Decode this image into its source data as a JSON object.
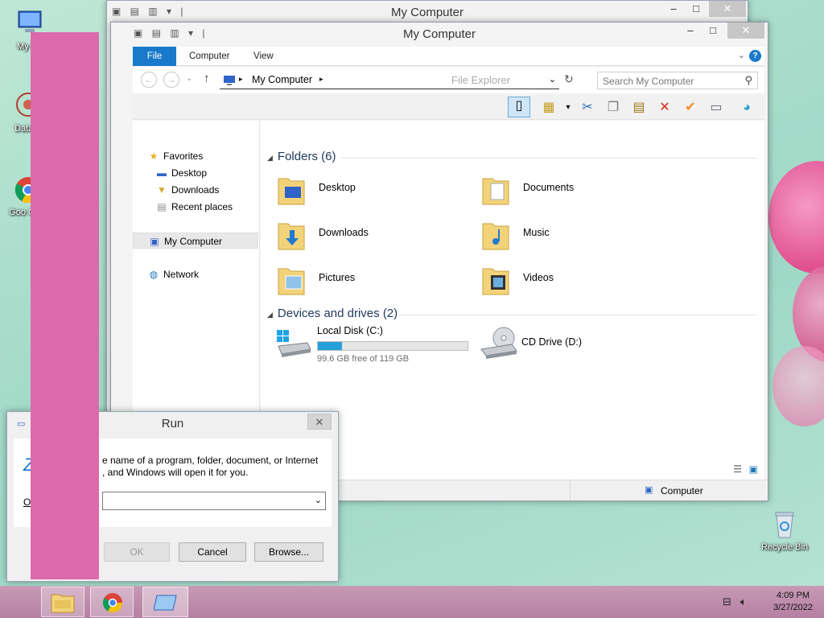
{
  "desktop": {
    "icons": [
      {
        "label": "My Co"
      },
      {
        "label": "DataW"
      },
      {
        "label": "Goo Chro"
      },
      {
        "label": "Recycle Bin"
      }
    ]
  },
  "back_window": {
    "title": "My Computer"
  },
  "explorer": {
    "title": "My Computer",
    "tabs": [
      "File",
      "Computer",
      "View"
    ],
    "address": "My Computer",
    "address_hint": "File Explorer",
    "search_placeholder": "Search My Computer",
    "nav": {
      "favorites": "Favorites",
      "desktop": "Desktop",
      "downloads": "Downloads",
      "recent": "Recent places",
      "computer": "My Computer",
      "network": "Network"
    },
    "folders_header": "Folders (6)",
    "folders": [
      "Desktop",
      "Documents",
      "Downloads",
      "Music",
      "Pictures",
      "Videos"
    ],
    "drives_header": "Devices and drives (2)",
    "drives": {
      "c_label": "Local Disk (C:)",
      "c_free": "99.6 GB free of 119 GB",
      "c_used_fraction": 0.163,
      "d_label": "CD Drive (D:)"
    },
    "status_location": "Computer"
  },
  "run": {
    "title": "Run",
    "description": "e name of a program, folder, document, or Internet , and Windows will open it for you.",
    "open_label": "O",
    "ok": "OK",
    "cancel": "Cancel",
    "browse": "Browse..."
  },
  "tray": {
    "time": "4:09 PM",
    "date": "3/27/2022"
  },
  "colors": {
    "accent": "#1979ca",
    "overlay": "#dc6aab",
    "drive_fill": "#26a0da"
  }
}
